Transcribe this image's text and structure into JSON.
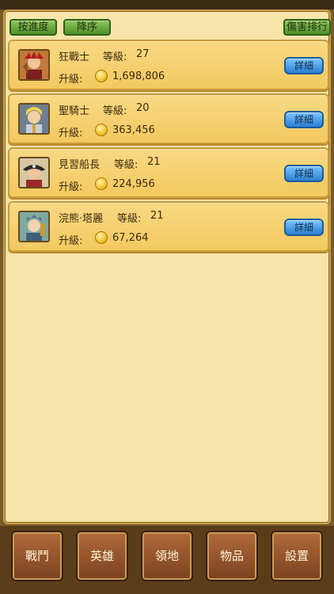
{
  "top_bar": {
    "sort_progress": "按進度",
    "descending": "降序",
    "damage_ranking": "傷害排行"
  },
  "heroes": [
    {
      "name": "狂戰士",
      "level_label": "等級:",
      "level": "27",
      "upgrade_label": "升級:",
      "cost": "1,698,806",
      "detail": "詳細"
    },
    {
      "name": "聖騎士",
      "level_label": "等級:",
      "level": "20",
      "upgrade_label": "升級:",
      "cost": "363,456",
      "detail": "詳細"
    },
    {
      "name": "見習船長",
      "level_label": "等級:",
      "level": "21",
      "upgrade_label": "升級:",
      "cost": "224,956",
      "detail": "詳細"
    },
    {
      "name": "浣熊·塔麗",
      "level_label": "等級:",
      "level": "21",
      "upgrade_label": "升級:",
      "cost": "67,264",
      "detail": "詳細"
    }
  ],
  "nav": {
    "battle": "戰鬥",
    "heroes": "英雄",
    "territory": "領地",
    "items": "物品",
    "settings": "設置"
  },
  "icons": {
    "coin": "gold-coin-icon",
    "portraits": [
      "berserker-portrait",
      "paladin-portrait",
      "captain-portrait",
      "raccoon-portrait"
    ]
  }
}
